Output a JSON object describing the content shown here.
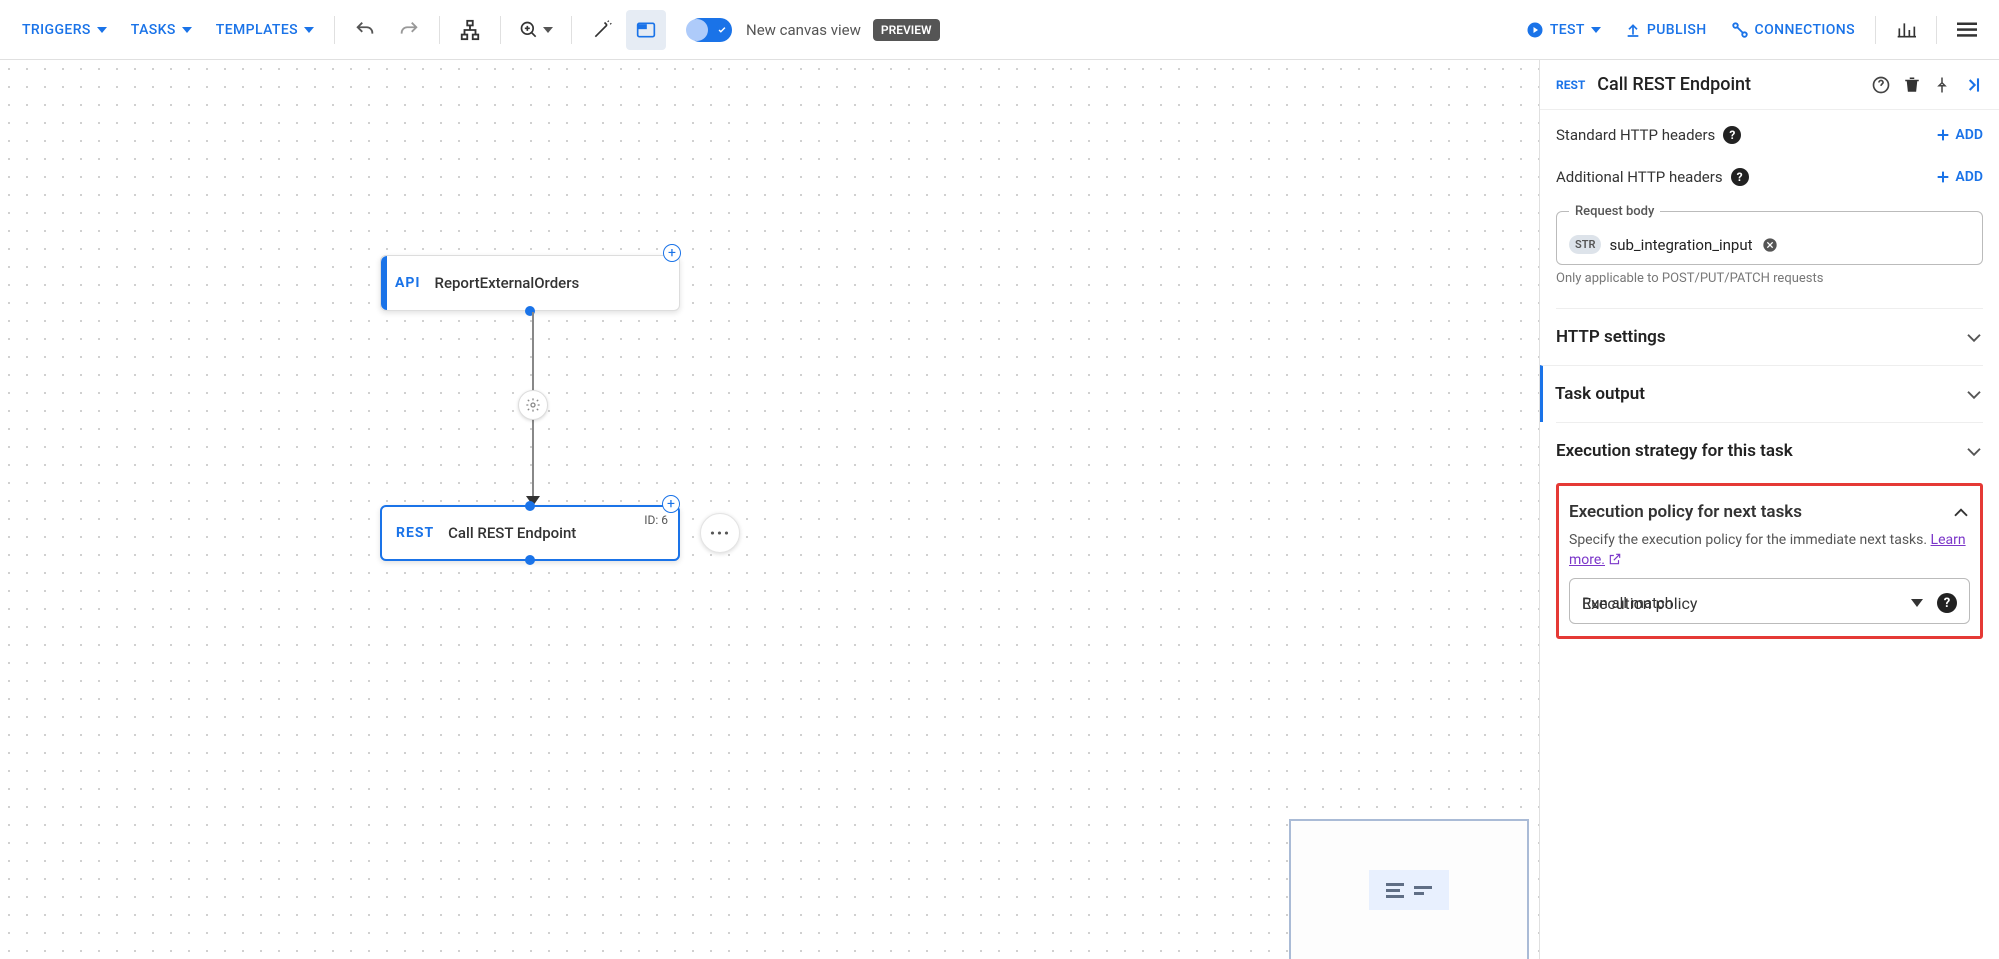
{
  "toolbar": {
    "triggers": "TRIGGERS",
    "tasks": "TASKS",
    "templates": "TEMPLATES",
    "canvas_view_label": "New canvas view",
    "preview_badge": "PREVIEW",
    "test": "TEST",
    "publish": "PUBLISH",
    "connections": "CONNECTIONS"
  },
  "canvas": {
    "trigger_node": {
      "type": "API",
      "title": "ReportExternalOrders"
    },
    "task_node": {
      "type": "REST",
      "title": "Call REST Endpoint",
      "id_label": "ID: 6"
    }
  },
  "sidepanel": {
    "badge": "REST",
    "title": "Call REST Endpoint",
    "standard_headers_label": "Standard HTTP headers",
    "additional_headers_label": "Additional HTTP headers",
    "add_label": "ADD",
    "request_body": {
      "legend": "Request body",
      "chip_type": "STR",
      "chip_value": "sub_integration_input",
      "helper": "Only applicable to POST/PUT/PATCH requests"
    },
    "sections": {
      "http_settings": "HTTP settings",
      "task_output": "Task output",
      "execution_strategy": "Execution strategy for this task"
    },
    "execution_policy": {
      "heading": "Execution policy for next tasks",
      "hint_text": "Specify the execution policy for the immediate next tasks. ",
      "learn_more": "Learn more.",
      "select_legend": "Execution policy",
      "select_value": "Run all match"
    }
  }
}
